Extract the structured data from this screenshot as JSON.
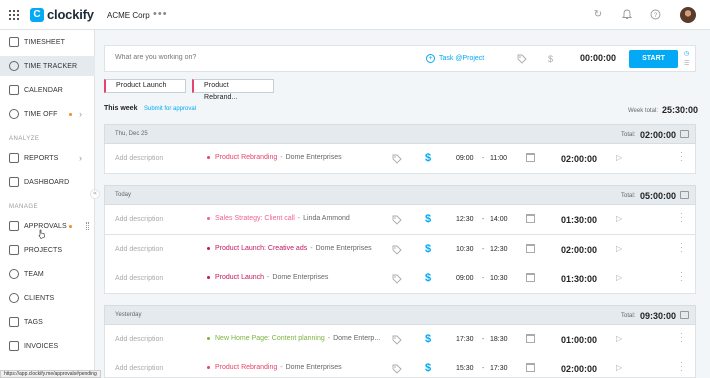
{
  "app": {
    "name": "clockify",
    "workspace": "ACME Corp",
    "more": "•••"
  },
  "sidebar": {
    "items": [
      {
        "id": "timesheet",
        "label": "TIMESHEET"
      },
      {
        "id": "time-tracker",
        "label": "TIME TRACKER",
        "active": true
      },
      {
        "id": "calendar",
        "label": "CALENDAR"
      },
      {
        "id": "time-off",
        "label": "TIME OFF"
      }
    ],
    "analyze_label": "ANALYZE",
    "analyze_items": [
      {
        "id": "reports",
        "label": "REPORTS"
      },
      {
        "id": "dashboard",
        "label": "DASHBOARD"
      }
    ],
    "manage_label": "MANAGE",
    "manage_items": [
      {
        "id": "approvals",
        "label": "APPROVALS"
      },
      {
        "id": "projects",
        "label": "PROJECTS"
      },
      {
        "id": "team",
        "label": "TEAM"
      },
      {
        "id": "clients",
        "label": "CLIENTS"
      },
      {
        "id": "tags",
        "label": "TAGS"
      },
      {
        "id": "invoices",
        "label": "INVOICES"
      }
    ]
  },
  "timer": {
    "placeholder": "What are you working on?",
    "task_project": "Task @Project",
    "time": "00:00:00",
    "start_label": "START"
  },
  "favorites": [
    "Product Launch",
    "Product Rebrand..."
  ],
  "week": {
    "label": "This week",
    "submit_label": "Submit for approval",
    "total_label": "Week total:",
    "total": "25:30:00"
  },
  "days": [
    {
      "label": "Thu, Dec 25",
      "total_label": "Total:",
      "total": "02:00:00",
      "entries": [
        {
          "description": "Add description",
          "project": "Product Rebranding",
          "client": "Dome Enterprises",
          "color": "#e5446d",
          "start": "09:00",
          "end": "11:00",
          "duration": "02:00:00"
        }
      ]
    },
    {
      "label": "Today",
      "total_label": "Total:",
      "total": "05:00:00",
      "entries": [
        {
          "description": "Add description",
          "project": "Sales Strategy: Client call",
          "client": "Linda Ammond",
          "color": "#f06292",
          "start": "12:30",
          "end": "14:00",
          "duration": "01:30:00"
        },
        {
          "description": "Add description",
          "project": "Product Launch: Creative ads",
          "client": "Dome Enterprises",
          "color": "#c2185b",
          "start": "10:30",
          "end": "12:30",
          "duration": "02:00:00"
        },
        {
          "description": "Add description",
          "project": "Product Launch",
          "client": "Dome Enterprises",
          "color": "#c2185b",
          "start": "09:00",
          "end": "10:30",
          "duration": "01:30:00"
        }
      ]
    },
    {
      "label": "Yesterday",
      "total_label": "Total:",
      "total": "09:30:00",
      "entries": [
        {
          "description": "Add description",
          "project": "New Home Page: Content planning",
          "client": "Dome Enterp...",
          "color": "#7cb342",
          "start": "17:30",
          "end": "18:30",
          "duration": "01:00:00"
        },
        {
          "description": "Add description",
          "project": "Product Rebranding",
          "client": "Dome Enterprises",
          "color": "#e5446d",
          "start": "15:30",
          "end": "17:30",
          "duration": "02:00:00"
        }
      ]
    }
  ],
  "status_url": "https://app.clockify.me/approvals#pending"
}
